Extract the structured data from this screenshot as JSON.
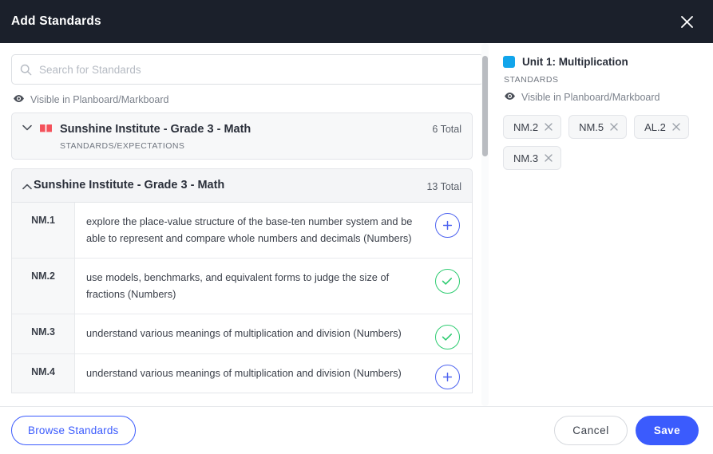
{
  "header": {
    "title": "Add Standards",
    "close_icon": "close-icon"
  },
  "search": {
    "placeholder": "Search for Standards",
    "value": "",
    "icon": "search-icon"
  },
  "visibility": {
    "icon": "eye-icon",
    "label": "Visible in Planboard/Markboard"
  },
  "groups": [
    {
      "chevron_icon": "chevron-down-icon",
      "book_icon": "book-icon",
      "book_color": "#F4515B",
      "title": "Sunshine Institute - Grade 3 - Math",
      "subtitle": "STANDARDS/EXPECTATIONS",
      "total": "6 Total",
      "expanded": false
    },
    {
      "chevron_icon": "chevron-up-icon",
      "title": "Sunshine Institute - Grade 3 - Math",
      "total": "13 Total",
      "expanded": true
    }
  ],
  "standards": [
    {
      "code": "NM.1",
      "description": "explore the place-value structure of the base-ten number system and be able to represent and compare whole numbers and decimals (Numbers)",
      "action": "add",
      "action_icon": "plus-circle-icon"
    },
    {
      "code": "NM.2",
      "description": "use models, benchmarks, and equivalent forms to judge the size of fractions (Numbers)",
      "action": "selected",
      "action_icon": "check-circle-icon"
    },
    {
      "code": "NM.3",
      "description": "understand various meanings of multiplication and division (Numbers)",
      "action": "selected",
      "action_icon": "check-circle-icon"
    },
    {
      "code": "NM.4",
      "description": "understand various meanings of multiplication and division (Numbers)",
      "action": "add",
      "action_icon": "plus-circle-icon"
    }
  ],
  "right_panel": {
    "unit_color": "#12A5EB",
    "unit_name": "Unit 1: Multiplication",
    "standards_label": "STANDARDS",
    "visibility_icon": "eye-icon",
    "visibility_label": "Visible in Planboard/Markboard",
    "chips": [
      {
        "label": "NM.2",
        "remove_icon": "close-icon"
      },
      {
        "label": "NM.5",
        "remove_icon": "close-icon"
      },
      {
        "label": "AL.2",
        "remove_icon": "close-icon"
      },
      {
        "label": "NM.3",
        "remove_icon": "close-icon"
      }
    ]
  },
  "footer": {
    "browse_label": "Browse Standards",
    "cancel_label": "Cancel",
    "save_label": "Save"
  },
  "colors": {
    "accent_blue": "#3b5bfd",
    "success_green": "#2ecc71",
    "header_bg": "#1b202b",
    "unit_blue": "#12A5EB",
    "book_red": "#F4515B"
  }
}
